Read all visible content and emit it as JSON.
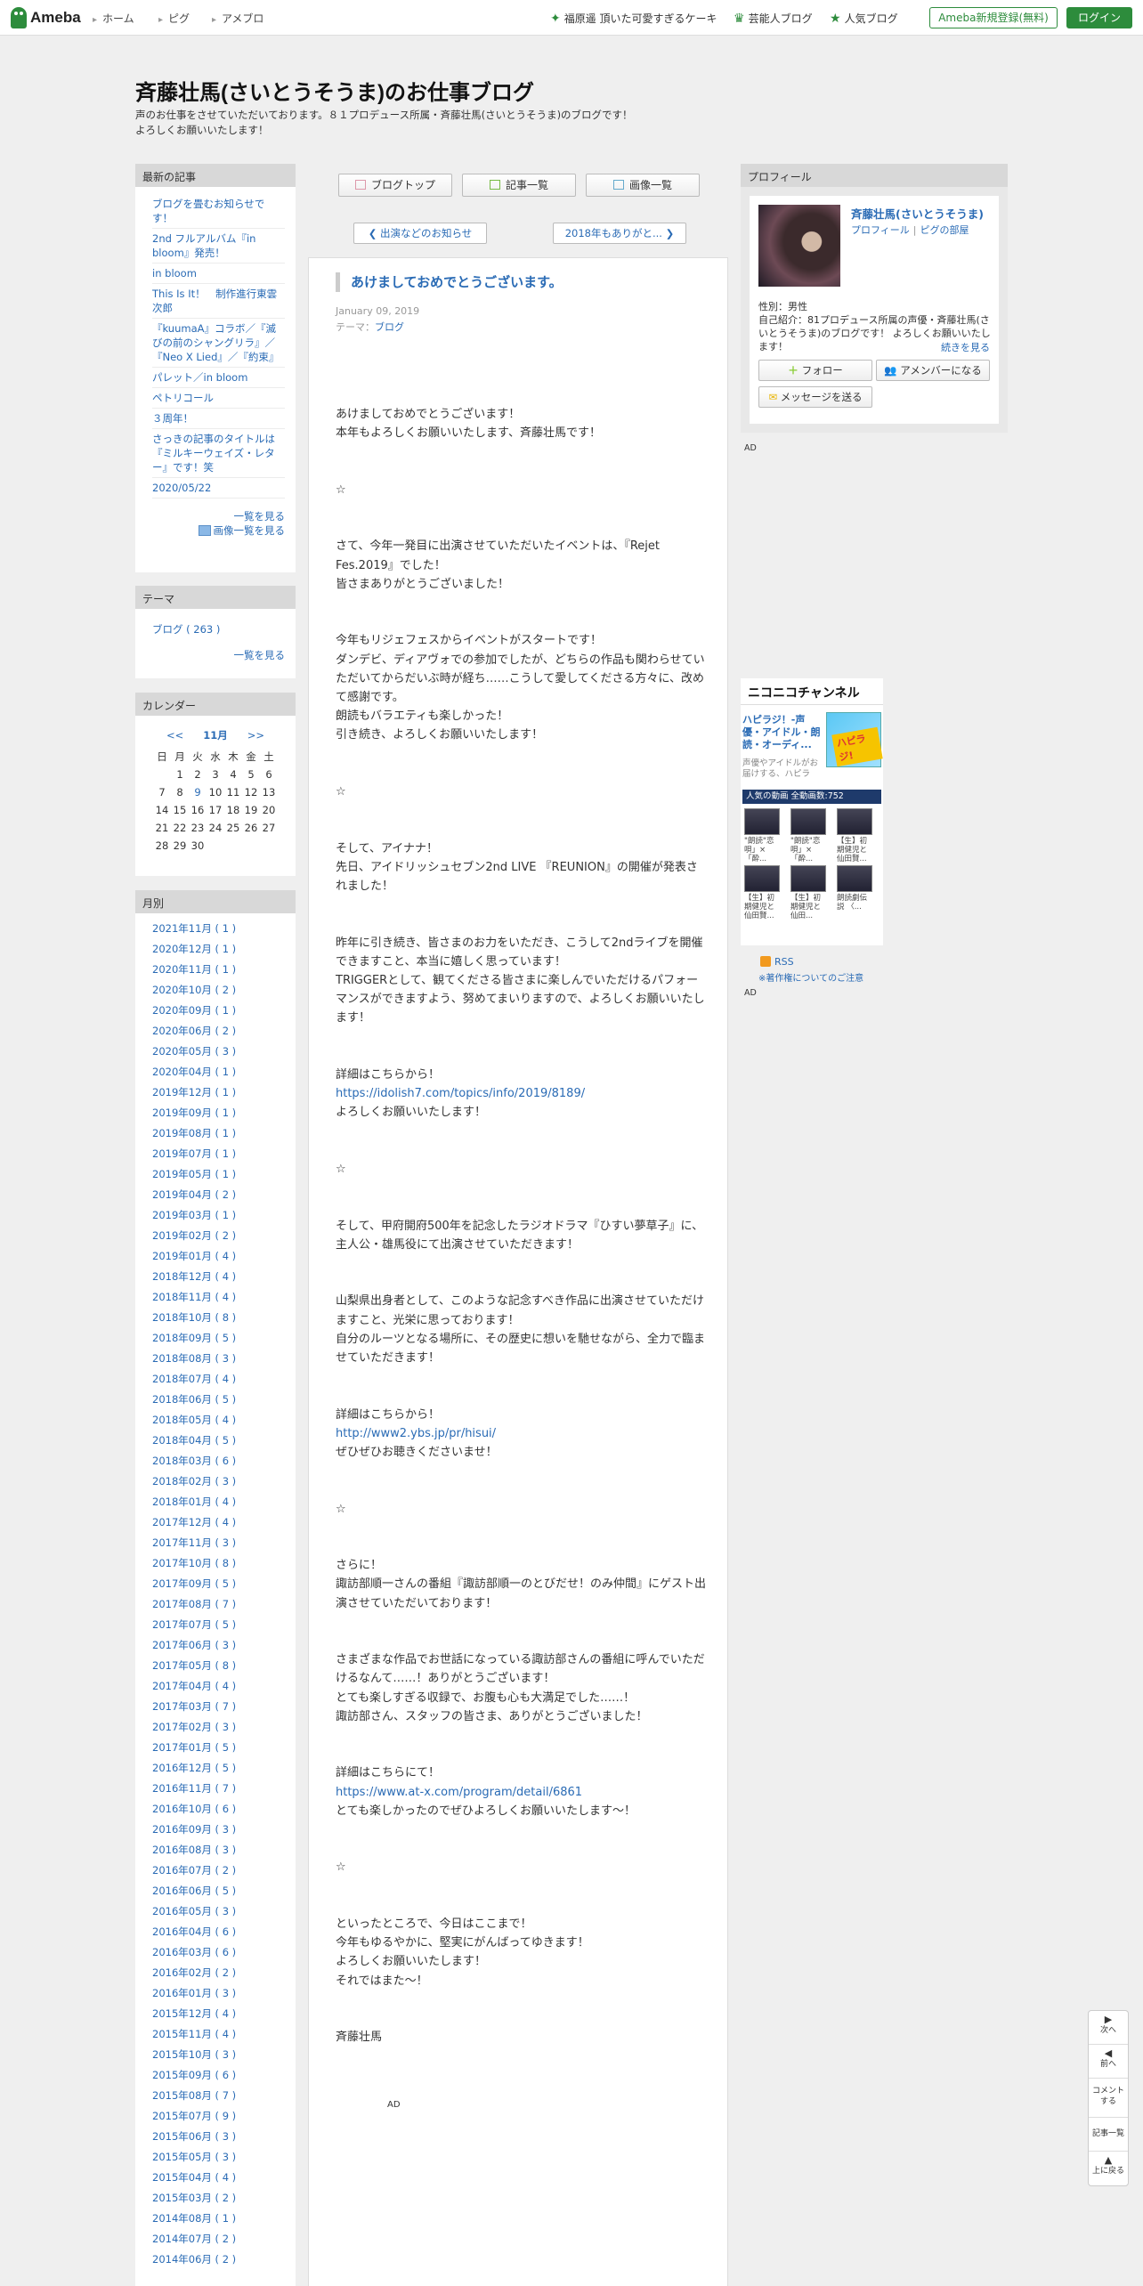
{
  "topbar": {
    "logo_text": "Ameba",
    "nav": [
      "ホーム",
      "ピグ",
      "アメブロ"
    ],
    "promo": [
      {
        "icon": "diamond-icon",
        "label": "福原遥 頂いた可愛すぎるケーキ"
      },
      {
        "icon": "crown-icon",
        "label": "芸能人ブログ"
      },
      {
        "icon": "star-icon",
        "label": "人気ブログ"
      }
    ],
    "register_label": "Ameba新規登録(無料)",
    "login_label": "ログイン"
  },
  "header": {
    "title": "斉藤壮馬(さいとうそうま)のお仕事ブログ",
    "desc_line1": "声のお仕事をさせていただいております。８１プロデュース所属・斉藤壮馬(さいとうそうま)のブログです！",
    "desc_line2": "よろしくお願いいたします！"
  },
  "recent": {
    "heading": "最新の記事",
    "items": [
      "ブログを畳むお知らせです！",
      "2nd フルアルバム『in bloom』発売！",
      "in bloom",
      "This Is It！　制作進行東雲次郎",
      "『kuumaA』コラボ／『滅びの前のシャングリラ』／『Neo X Lied』／『約束』",
      "パレット／in bloom",
      "ペトリコール",
      "３周年！",
      "さっきの記事のタイトルは『ミルキーウェイズ・レター』です！笑",
      "2020/05/22"
    ],
    "more": "一覧を見る",
    "image_more": "画像一覧を見る"
  },
  "theme": {
    "heading": "テーマ",
    "items": [
      "ブログ ( 263 )"
    ],
    "more": "一覧を見る"
  },
  "calendar": {
    "heading": "カレンダー",
    "prev": "<<",
    "month": "11月",
    "next": ">>",
    "weekdays": [
      "日",
      "月",
      "火",
      "水",
      "木",
      "金",
      "土"
    ],
    "weeks": [
      [
        "",
        "1",
        "2",
        "3",
        "4",
        "5",
        "6"
      ],
      [
        "7",
        "8",
        "9",
        "10",
        "11",
        "12",
        "13"
      ],
      [
        "14",
        "15",
        "16",
        "17",
        "18",
        "19",
        "20"
      ],
      [
        "21",
        "22",
        "23",
        "24",
        "25",
        "26",
        "27"
      ],
      [
        "28",
        "29",
        "30",
        "",
        "",
        "",
        ""
      ]
    ],
    "linked_day": "9"
  },
  "monthly": {
    "heading": "月別",
    "items": [
      "2021年11月 ( 1 )",
      "2020年12月 ( 1 )",
      "2020年11月 ( 1 )",
      "2020年10月 ( 2 )",
      "2020年09月 ( 1 )",
      "2020年06月 ( 2 )",
      "2020年05月 ( 3 )",
      "2020年04月 ( 1 )",
      "2019年12月 ( 1 )",
      "2019年09月 ( 1 )",
      "2019年08月 ( 1 )",
      "2019年07月 ( 1 )",
      "2019年05月 ( 1 )",
      "2019年04月 ( 2 )",
      "2019年03月 ( 1 )",
      "2019年02月 ( 2 )",
      "2019年01月 ( 4 )",
      "2018年12月 ( 4 )",
      "2018年11月 ( 4 )",
      "2018年10月 ( 8 )",
      "2018年09月 ( 5 )",
      "2018年08月 ( 3 )",
      "2018年07月 ( 4 )",
      "2018年06月 ( 5 )",
      "2018年05月 ( 4 )",
      "2018年04月 ( 5 )",
      "2018年03月 ( 6 )",
      "2018年02月 ( 3 )",
      "2018年01月 ( 4 )",
      "2017年12月 ( 4 )",
      "2017年11月 ( 3 )",
      "2017年10月 ( 8 )",
      "2017年09月 ( 5 )",
      "2017年08月 ( 7 )",
      "2017年07月 ( 5 )",
      "2017年06月 ( 3 )",
      "2017年05月 ( 8 )",
      "2017年04月 ( 4 )",
      "2017年03月 ( 7 )",
      "2017年02月 ( 3 )",
      "2017年01月 ( 5 )",
      "2016年12月 ( 5 )",
      "2016年11月 ( 7 )",
      "2016年10月 ( 6 )",
      "2016年09月 ( 3 )",
      "2016年08月 ( 3 )",
      "2016年07月 ( 2 )",
      "2016年06月 ( 5 )",
      "2016年05月 ( 3 )",
      "2016年04月 ( 6 )",
      "2016年03月 ( 6 )",
      "2016年02月 ( 2 )",
      "2016年01月 ( 3 )",
      "2015年12月 ( 4 )",
      "2015年11月 ( 4 )",
      "2015年10月 ( 3 )",
      "2015年09月 ( 6 )",
      "2015年08月 ( 7 )",
      "2015年07月 ( 9 )",
      "2015年06月 ( 3 )",
      "2015年05月 ( 3 )",
      "2015年04月 ( 4 )",
      "2015年03月 ( 2 )",
      "2014年08月 ( 1 )",
      "2014年07月 ( 2 )",
      "2014年06月 ( 2 )"
    ]
  },
  "nav_buttons": {
    "top": "ブログトップ",
    "articles": "記事一覧",
    "images": "画像一覧"
  },
  "pager": {
    "prev": "出演などのお知らせ",
    "next": "2018年もありがと..."
  },
  "article": {
    "title": "あけましておめでとうございます。",
    "date": "January 09, 2019",
    "theme_label": "テーマ：",
    "theme_value": "ブログ",
    "blocks": [
      [
        "あけましておめでとうございます！",
        "本年もよろしくお願いいたします、斉藤壮馬です！"
      ],
      [
        "☆"
      ],
      [
        "さて、今年一発目に出演させていただいたイベントは、『Rejet Fes.2019』でした！",
        "皆さまありがとうございました！"
      ],
      [
        "今年もリジェフェスからイベントがスタートです！",
        "ダンデビ、ディアヴォでの参加でしたが、どちらの作品も関わらせていただいてからだいぶ時が経ち……こうして愛してくださる方々に、改めて感謝です。",
        "朗読もバラエティも楽しかった！",
        "引き続き、よろしくお願いいたします！"
      ],
      [
        "☆"
      ],
      [
        "そして、アイナナ！",
        "先日、アイドリッシュセブン2nd LIVE 『REUNION』の開催が発表されました！"
      ],
      [
        "昨年に引き続き、皆さまのお力をいただき、こうして2ndライブを開催できますこと、本当に嬉しく思っています！",
        "TRIGGERとして、観てくださる皆さまに楽しんでいただけるパフォーマンスができますよう、努めてまいりますので、よろしくお願いいたします！"
      ],
      [
        "詳細はこちらから！",
        "https://idolish7.com/topics/info/2019/8189/",
        "よろしくお願いいたします！"
      ],
      [
        "☆"
      ],
      [
        "そして、甲府開府500年を記念したラジオドラマ『ひすい夢草子』に、主人公・雄馬役にて出演させていただきます！"
      ],
      [
        "山梨県出身者として、このような記念すべき作品に出演させていただけますこと、光栄に思っております！",
        "自分のルーツとなる場所に、その歴史に想いを馳せながら、全力で臨ませていただきます！"
      ],
      [
        "詳細はこちらから！",
        "http://www2.ybs.jp/pr/hisui/",
        "ぜひぜひお聴きくださいませ！"
      ],
      [
        "☆"
      ],
      [
        "さらに！",
        "諏訪部順一さんの番組『諏訪部順一のとびだせ！のみ仲間』にゲスト出演させていただいております！"
      ],
      [
        "さまざまな作品でお世話になっている諏訪部さんの番組に呼んでいただけるなんて……！ありがとうございます！",
        "とても楽しすぎる収録で、お腹も心も大満足でした……！",
        "諏訪部さん、スタッフの皆さま、ありがとうございました！"
      ],
      [
        "詳細はこちらにて！",
        "https://www.at-x.com/program/detail/6861",
        "とても楽しかったのでぜひよろしくお願いいたします〜！"
      ],
      [
        "☆"
      ],
      [
        "といったところで、今日はここまで！",
        "今年もゆるやかに、堅実にがんばってゆきます！",
        "よろしくお願いいたします！",
        "それではまた〜！"
      ],
      [
        "斉藤壮馬"
      ]
    ],
    "ad_label": "AD"
  },
  "profile": {
    "heading": "プロフィール",
    "name": "斉藤壮馬(さいとうそうま)",
    "link_profile": "プロフィール",
    "link_room": "ピグの部屋",
    "gender": "性別：男性",
    "intro": "自己紹介：81プロデュース所属の声優・斉藤壮馬(さいとうそうま)のブログです！ よろしくお願いいたします！",
    "more": "続きを見る",
    "follow": "フォロー",
    "member": "アメンバーになる",
    "message": "メッセージを送る"
  },
  "ad_label": "AD",
  "nico": {
    "logo": "ニコニコチャンネル",
    "title": "ハピラジ！-声優・アイドル・朗読・オーディ...",
    "subtitle": "声優やアイドルがお届けする、ハピラ",
    "thumb_text": "ハピラジ!",
    "bar": "人気の動画 全動画数:752",
    "videos": [
      "\"朗読\"恋唄」×「酔...",
      "\"朗読\"恋唄」×「酔...",
      "【生】初期健児と仙田賢...",
      "【生】初期健児と仙田賢...",
      "【生】初期健児と仙田...",
      "朗読劇伝説 〈..."
    ]
  },
  "rss": {
    "label": "RSS",
    "note": "※著作権についてのご注意"
  },
  "floatnav": {
    "next": "次へ",
    "prev": "前へ",
    "comment": "コメントする",
    "list": "記事一覧",
    "top": "上に戻る"
  }
}
